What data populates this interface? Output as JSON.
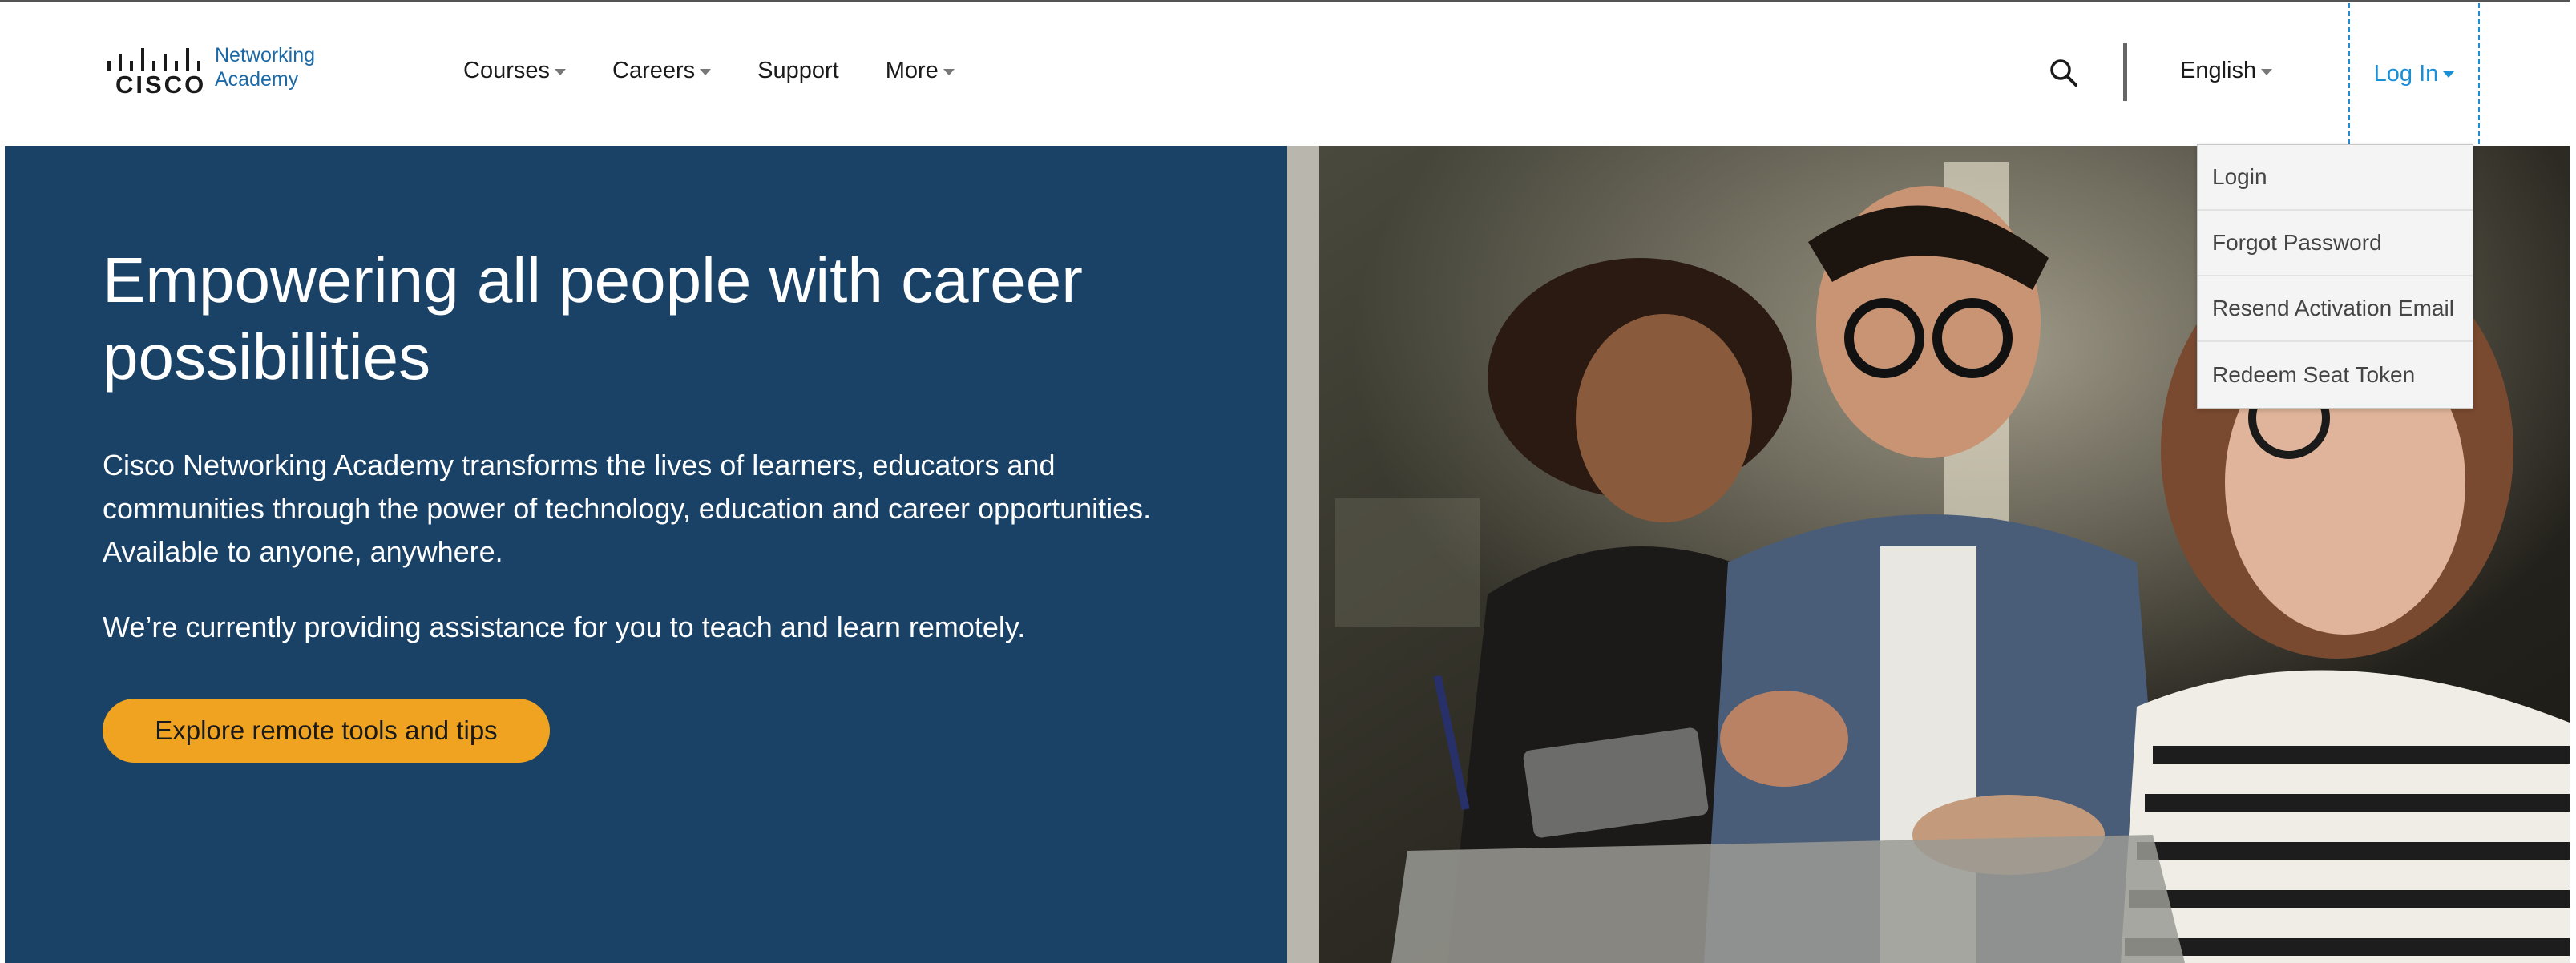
{
  "brand": {
    "logo_wordmark": "CISCO",
    "name_line1": "Networking",
    "name_line2": "Academy"
  },
  "nav": {
    "items": [
      {
        "label": "Courses",
        "has_caret": true
      },
      {
        "label": "Careers",
        "has_caret": true
      },
      {
        "label": "Support",
        "has_caret": false
      },
      {
        "label": "More",
        "has_caret": true
      }
    ]
  },
  "header": {
    "search_icon": "search-icon",
    "language": "English",
    "login_label": "Log In"
  },
  "login_menu": {
    "items": [
      "Login",
      "Forgot Password",
      "Resend Activation Email",
      "Redeem Seat Token"
    ]
  },
  "hero": {
    "title": "Empowering all people with career possibilities",
    "description": "Cisco Networking Academy transforms the lives of learners, educators and communities through the power of technology, education and career opportunities. Available to anyone, anywhere.",
    "remote_note": "We’re currently providing assistance for you to teach and learn remotely.",
    "cta_label": "Explore remote tools and tips"
  },
  "colors": {
    "hero_background": "#1a4267",
    "cta_background": "#f0a321",
    "link_blue": "#1b8fd6",
    "brand_blue": "#1b6aa7"
  }
}
